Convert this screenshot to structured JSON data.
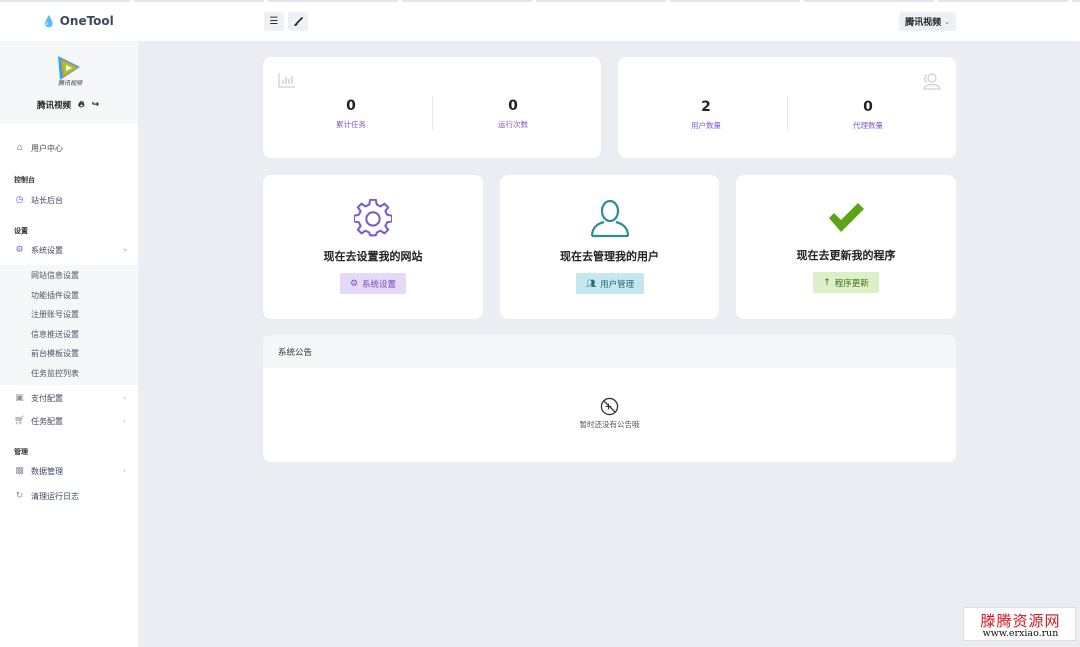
{
  "app": {
    "name": "OneTool"
  },
  "header": {
    "menu_icon": "hamburger-icon",
    "theme_icon": "brush-icon",
    "user_label": "腾讯视频"
  },
  "sidebar": {
    "profile": {
      "logo_text": "腾讯视频",
      "name": "腾讯视频"
    },
    "user_center": "用户中心",
    "section_console": "控制台",
    "site_admin": "站长后台",
    "section_settings": "设置",
    "system_settings": "系统设置",
    "sub_items": [
      "网站信息设置",
      "功能插件设置",
      "注册账号设置",
      "信息推送设置",
      "前台模板设置",
      "任务监控列表"
    ],
    "payment_config": "支付配置",
    "task_config": "任务配置",
    "section_manage": "管理",
    "data_manage": "数据管理",
    "clear_logs": "清理运行日志"
  },
  "stats": {
    "left": [
      {
        "value": "0",
        "label": "累计任务"
      },
      {
        "value": "0",
        "label": "运行次数"
      }
    ],
    "right": [
      {
        "value": "2",
        "label": "用户数量"
      },
      {
        "value": "0",
        "label": "代理数量"
      }
    ]
  },
  "actions": [
    {
      "title": "现在去设置我的网站",
      "button": "系统设置",
      "icon": "gear-icon",
      "button_icon": "gear-icon"
    },
    {
      "title": "现在去管理我的用户",
      "button": "用户管理",
      "icon": "user-icon",
      "button_icon": "users-icon"
    },
    {
      "title": "现在去更新我的程序",
      "button": "程序更新",
      "icon": "check-icon",
      "button_icon": "arrow-up-icon"
    }
  ],
  "notice": {
    "title": "系统公告",
    "empty_text": "暂时还没有公告哦"
  },
  "watermark": {
    "cn": "滕腾资源网",
    "url": "www.erxiao.run"
  },
  "colors": {
    "accent_purple": "#7b5ccf",
    "accent_teal": "#2b8c9a",
    "accent_green": "#5ea317",
    "background": "#ebedf2"
  }
}
